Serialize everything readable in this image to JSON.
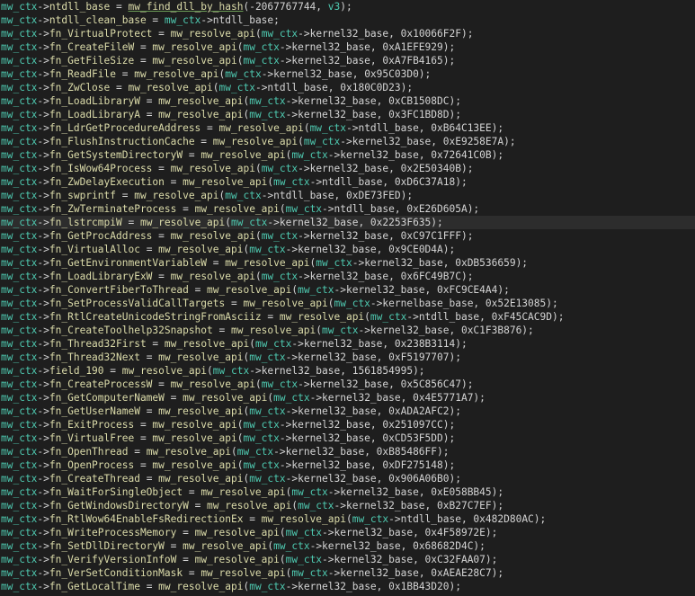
{
  "colors": {
    "background": "#1e1e1e",
    "highlight_line": "#2d2d2d",
    "variable": "#4ec9b0",
    "function": "#dcdcaa",
    "text": "#d4d4d4"
  },
  "code_lines": [
    {
      "var": "mw_ctx",
      "arrow": "->",
      "target": "ntdll_base",
      "eq": " = ",
      "func": "mw_find_dll_by_hash",
      "args_before": "(-2067767744, ",
      "arg_var": "v3",
      "args_after": ");"
    },
    {
      "var": "mw_ctx",
      "arrow": "->",
      "target": "ntdll_clean_base",
      "eq": " = ",
      "func": "",
      "args_before": "",
      "arg_var": "mw_ctx",
      "args_after": "->ntdll_base;"
    },
    {
      "var": "mw_ctx",
      "arrow": "->",
      "target": "fn_VirtualProtect",
      "eq": " = ",
      "func": "mw_resolve_api",
      "args_before": "(",
      "arg_var": "mw_ctx",
      "args_after": "->kernel32_base, 0x10066F2F);"
    },
    {
      "var": "mw_ctx",
      "arrow": "->",
      "target": "fn_CreateFileW",
      "eq": " = ",
      "func": "mw_resolve_api",
      "args_before": "(",
      "arg_var": "mw_ctx",
      "args_after": "->kernel32_base, 0xA1EFE929);"
    },
    {
      "var": "mw_ctx",
      "arrow": "->",
      "target": "fn_GetFileSize",
      "eq": " = ",
      "func": "mw_resolve_api",
      "args_before": "(",
      "arg_var": "mw_ctx",
      "args_after": "->kernel32_base, 0xA7FB4165);"
    },
    {
      "var": "mw_ctx",
      "arrow": "->",
      "target": "fn_ReadFile",
      "eq": " = ",
      "func": "mw_resolve_api",
      "args_before": "(",
      "arg_var": "mw_ctx",
      "args_after": "->kernel32_base, 0x95C03D0);"
    },
    {
      "var": "mw_ctx",
      "arrow": "->",
      "target": "fn_ZwClose",
      "eq": " = ",
      "func": "mw_resolve_api",
      "args_before": "(",
      "arg_var": "mw_ctx",
      "args_after": "->ntdll_base, 0x180C0D23);"
    },
    {
      "var": "mw_ctx",
      "arrow": "->",
      "target": "fn_LoadLibraryW",
      "eq": " = ",
      "func": "mw_resolve_api",
      "args_before": "(",
      "arg_var": "mw_ctx",
      "args_after": "->kernel32_base, 0xCB1508DC);"
    },
    {
      "var": "mw_ctx",
      "arrow": "->",
      "target": "fn_LoadLibraryA",
      "eq": " = ",
      "func": "mw_resolve_api",
      "args_before": "(",
      "arg_var": "mw_ctx",
      "args_after": "->kernel32_base, 0x3FC1BD8D);"
    },
    {
      "var": "mw_ctx",
      "arrow": "->",
      "target": "fn_LdrGetProcedureAddress",
      "eq": " = ",
      "func": "mw_resolve_api",
      "args_before": "(",
      "arg_var": "mw_ctx",
      "args_after": "->ntdll_base, 0xB64C13EE);"
    },
    {
      "var": "mw_ctx",
      "arrow": "->",
      "target": "fn_FlushInstructionCache",
      "eq": " = ",
      "func": "mw_resolve_api",
      "args_before": "(",
      "arg_var": "mw_ctx",
      "args_after": "->kernel32_base, 0xE9258E7A);"
    },
    {
      "var": "mw_ctx",
      "arrow": "->",
      "target": "fn_GetSystemDirectoryW",
      "eq": " = ",
      "func": "mw_resolve_api",
      "args_before": "(",
      "arg_var": "mw_ctx",
      "args_after": "->kernel32_base, 0x72641C0B);"
    },
    {
      "var": "mw_ctx",
      "arrow": "->",
      "target": "fn_IsWow64Process",
      "eq": " = ",
      "func": "mw_resolve_api",
      "args_before": "(",
      "arg_var": "mw_ctx",
      "args_after": "->kernel32_base, 0x2E50340B);"
    },
    {
      "var": "mw_ctx",
      "arrow": "->",
      "target": "fn_ZwDelayExecution",
      "eq": " = ",
      "func": "mw_resolve_api",
      "args_before": "(",
      "arg_var": "mw_ctx",
      "args_after": "->ntdll_base, 0xD6C37A18);"
    },
    {
      "var": "mw_ctx",
      "arrow": "->",
      "target": "fn_swprintf",
      "eq": " = ",
      "func": "mw_resolve_api",
      "args_before": "(",
      "arg_var": "mw_ctx",
      "args_after": "->ntdll_base, 0xDE73FED);"
    },
    {
      "var": "mw_ctx",
      "arrow": "->",
      "target": "fn_ZwTerminateProcess",
      "eq": " = ",
      "func": "mw_resolve_api",
      "args_before": "(",
      "arg_var": "mw_ctx",
      "args_after": "->ntdll_base, 0xE26D605A);"
    },
    {
      "var": "mw_ctx",
      "arrow": "->",
      "target": "fn_lstrcmpiW",
      "eq": " = ",
      "func": "mw_resolve_api",
      "args_before": "(",
      "arg_var": "mw_ctx",
      "args_after": "->kernel32_base, 0x2253F635);",
      "highlight": true
    },
    {
      "var": "mw_ctx",
      "arrow": "->",
      "target": "fn_GetProcAddress",
      "eq": " = ",
      "func": "mw_resolve_api",
      "args_before": "(",
      "arg_var": "mw_ctx",
      "args_after": "->kernel32_base, 0xC97C1FFF);"
    },
    {
      "var": "mw_ctx",
      "arrow": "->",
      "target": "fn_VirtualAlloc",
      "eq": " = ",
      "func": "mw_resolve_api",
      "args_before": "(",
      "arg_var": "mw_ctx",
      "args_after": "->kernel32_base, 0x9CE0D4A);"
    },
    {
      "var": "mw_ctx",
      "arrow": "->",
      "target": "fn_GetEnvironmentVariableW",
      "eq": " = ",
      "func": "mw_resolve_api",
      "args_before": "(",
      "arg_var": "mw_ctx",
      "args_after": "->kernel32_base, 0xDB536659);"
    },
    {
      "var": "mw_ctx",
      "arrow": "->",
      "target": "fn_LoadLibraryExW",
      "eq": " = ",
      "func": "mw_resolve_api",
      "args_before": "(",
      "arg_var": "mw_ctx",
      "args_after": "->kernel32_base, 0x6FC49B7C);"
    },
    {
      "var": "mw_ctx",
      "arrow": "->",
      "target": "fn_ConvertFiberToThread",
      "eq": " = ",
      "func": "mw_resolve_api",
      "args_before": "(",
      "arg_var": "mw_ctx",
      "args_after": "->kernel32_base, 0xFC9CE4A4);"
    },
    {
      "var": "mw_ctx",
      "arrow": "->",
      "target": "fn_SetProcessValidCallTargets",
      "eq": " = ",
      "func": "mw_resolve_api",
      "args_before": "(",
      "arg_var": "mw_ctx",
      "args_after": "->kernelbase_base, 0x52E13085);"
    },
    {
      "var": "mw_ctx",
      "arrow": "->",
      "target": "fn_RtlCreateUnicodeStringFromAsciiz",
      "eq": " = ",
      "func": "mw_resolve_api",
      "args_before": "(",
      "arg_var": "mw_ctx",
      "args_after": "->ntdll_base, 0xF45CAC9D);"
    },
    {
      "var": "mw_ctx",
      "arrow": "->",
      "target": "fn_CreateToolhelp32Snapshot",
      "eq": " = ",
      "func": "mw_resolve_api",
      "args_before": "(",
      "arg_var": "mw_ctx",
      "args_after": "->kernel32_base, 0xC1F3B876);"
    },
    {
      "var": "mw_ctx",
      "arrow": "->",
      "target": "fn_Thread32First",
      "eq": " = ",
      "func": "mw_resolve_api",
      "args_before": "(",
      "arg_var": "mw_ctx",
      "args_after": "->kernel32_base, 0x238B3114);"
    },
    {
      "var": "mw_ctx",
      "arrow": "->",
      "target": "fn_Thread32Next",
      "eq": " = ",
      "func": "mw_resolve_api",
      "args_before": "(",
      "arg_var": "mw_ctx",
      "args_after": "->kernel32_base, 0xF5197707);"
    },
    {
      "var": "mw_ctx",
      "arrow": "->",
      "target": "field_190",
      "eq": " = ",
      "func": "mw_resolve_api",
      "args_before": "(",
      "arg_var": "mw_ctx",
      "args_after": "->kernel32_base, 1561854995);"
    },
    {
      "var": "mw_ctx",
      "arrow": "->",
      "target": "fn_CreateProcessW",
      "eq": " = ",
      "func": "mw_resolve_api",
      "args_before": "(",
      "arg_var": "mw_ctx",
      "args_after": "->kernel32_base, 0x5C856C47);"
    },
    {
      "var": "mw_ctx",
      "arrow": "->",
      "target": "fn_GetComputerNameW",
      "eq": " = ",
      "func": "mw_resolve_api",
      "args_before": "(",
      "arg_var": "mw_ctx",
      "args_after": "->kernel32_base, 0x4E5771A7);"
    },
    {
      "var": "mw_ctx",
      "arrow": "->",
      "target": "fn_GetUserNameW",
      "eq": " = ",
      "func": "mw_resolve_api",
      "args_before": "(",
      "arg_var": "mw_ctx",
      "args_after": "->kernel32_base, 0xADA2AFC2);"
    },
    {
      "var": "mw_ctx",
      "arrow": "->",
      "target": "fn_ExitProcess",
      "eq": " = ",
      "func": "mw_resolve_api",
      "args_before": "(",
      "arg_var": "mw_ctx",
      "args_after": "->kernel32_base, 0x251097CC);"
    },
    {
      "var": "mw_ctx",
      "arrow": "->",
      "target": "fn_VirtualFree",
      "eq": " = ",
      "func": "mw_resolve_api",
      "args_before": "(",
      "arg_var": "mw_ctx",
      "args_after": "->kernel32_base, 0xCD53F5DD);"
    },
    {
      "var": "mw_ctx",
      "arrow": "->",
      "target": "fn_OpenThread",
      "eq": " = ",
      "func": "mw_resolve_api",
      "args_before": "(",
      "arg_var": "mw_ctx",
      "args_after": "->kernel32_base, 0xB85486FF);"
    },
    {
      "var": "mw_ctx",
      "arrow": "->",
      "target": "fn_OpenProcess",
      "eq": " = ",
      "func": "mw_resolve_api",
      "args_before": "(",
      "arg_var": "mw_ctx",
      "args_after": "->kernel32_base, 0xDF275148);"
    },
    {
      "var": "mw_ctx",
      "arrow": "->",
      "target": "fn_CreateThread",
      "eq": " = ",
      "func": "mw_resolve_api",
      "args_before": "(",
      "arg_var": "mw_ctx",
      "args_after": "->kernel32_base, 0x906A06B0);"
    },
    {
      "var": "mw_ctx",
      "arrow": "->",
      "target": "fn_WaitForSingleObject",
      "eq": " = ",
      "func": "mw_resolve_api",
      "args_before": "(",
      "arg_var": "mw_ctx",
      "args_after": "->kernel32_base, 0xE058BB45);"
    },
    {
      "var": "mw_ctx",
      "arrow": "->",
      "target": "fn_GetWindowsDirectoryW",
      "eq": " = ",
      "func": "mw_resolve_api",
      "args_before": "(",
      "arg_var": "mw_ctx",
      "args_after": "->kernel32_base, 0xB27C7EF);"
    },
    {
      "var": "mw_ctx",
      "arrow": "->",
      "target": "fn_RtlWow64EnableFsRedirectionEx",
      "eq": " = ",
      "func": "mw_resolve_api",
      "args_before": "(",
      "arg_var": "mw_ctx",
      "args_after": "->ntdll_base, 0x482D80AC);"
    },
    {
      "var": "mw_ctx",
      "arrow": "->",
      "target": "fn_WriteProcessMemory",
      "eq": " = ",
      "func": "mw_resolve_api",
      "args_before": "(",
      "arg_var": "mw_ctx",
      "args_after": "->kernel32_base, 0x4F58972E);"
    },
    {
      "var": "mw_ctx",
      "arrow": "->",
      "target": "fn_SetDllDirectoryW",
      "eq": " = ",
      "func": "mw_resolve_api",
      "args_before": "(",
      "arg_var": "mw_ctx",
      "args_after": "->kernel32_base, 0x68682D4C);"
    },
    {
      "var": "mw_ctx",
      "arrow": "->",
      "target": "fn_VerifyVersionInfoW",
      "eq": " = ",
      "func": "mw_resolve_api",
      "args_before": "(",
      "arg_var": "mw_ctx",
      "args_after": "->kernel32_base, 0xC32FAA07);"
    },
    {
      "var": "mw_ctx",
      "arrow": "->",
      "target": "fn_VerSetConditionMask",
      "eq": " = ",
      "func": "mw_resolve_api",
      "args_before": "(",
      "arg_var": "mw_ctx",
      "args_after": "->kernel32_base, 0xAEAE28C7);"
    },
    {
      "var": "mw_ctx",
      "arrow": "->",
      "target": "fn_GetLocalTime",
      "eq": " = ",
      "func": "mw_resolve_api",
      "args_before": "(",
      "arg_var": "mw_ctx",
      "args_after": "->kernel32_base, 0x1BB43D20);"
    }
  ]
}
